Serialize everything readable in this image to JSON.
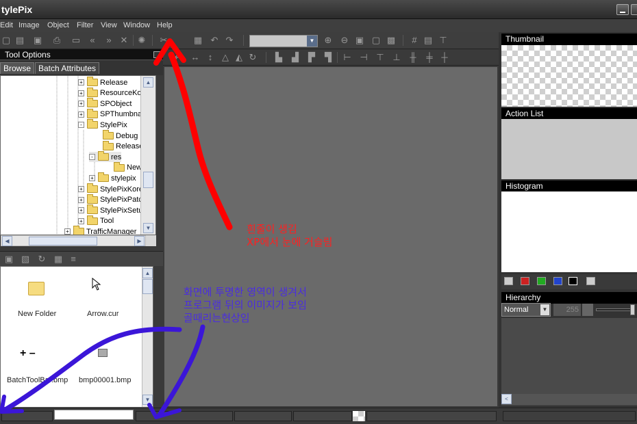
{
  "app": {
    "title": "tylePix"
  },
  "menu": [
    "Edit",
    "Image",
    "Object",
    "Filter",
    "View",
    "Window",
    "Help"
  ],
  "left_panel": {
    "header": "Tool Options",
    "tabs": [
      "Browse",
      "Batch Attributes"
    ],
    "tree": [
      {
        "label": "Release",
        "expander": "+"
      },
      {
        "label": "ResourceKor",
        "expander": "+"
      },
      {
        "label": "SPObject",
        "expander": "+"
      },
      {
        "label": "SPThumbnai",
        "expander": "+"
      },
      {
        "label": "StylePix",
        "expander": "-"
      },
      {
        "label": "Debug",
        "expander": ""
      },
      {
        "label": "Release",
        "expander": ""
      },
      {
        "label": "res",
        "expander": "-"
      },
      {
        "label": "New",
        "expander": ""
      },
      {
        "label": "stylepix",
        "expander": "+"
      },
      {
        "label": "StylePixKore",
        "expander": "+"
      },
      {
        "label": "StylePixPatc",
        "expander": "+"
      },
      {
        "label": "StylePixSetu",
        "expander": "+"
      },
      {
        "label": "Tool",
        "expander": "+"
      },
      {
        "label": "TrafficManager",
        "expander": "+"
      }
    ],
    "files": [
      {
        "name": "New Folder",
        "icon": "folder-icon"
      },
      {
        "name": "Arrow.cur",
        "icon": "cursor-icon"
      },
      {
        "name": "BatchToolBar.bmp",
        "icon": "plus-minus-icon"
      },
      {
        "name": "bmp00001.bmp",
        "icon": "bitmap-icon"
      }
    ]
  },
  "right_panel": {
    "thumbnail_header": "Thumbnail",
    "action_list_header": "Action List",
    "histogram_header": "Histogram",
    "hierarchy_header": "Hierarchy",
    "blend_mode": "Normal",
    "opacity": "255",
    "channel_colors": [
      "#cccccc",
      "#cc2222",
      "#22aa22",
      "#2244cc",
      "#000000",
      "#cccccc"
    ]
  },
  "annotations": {
    "red": [
      "흰줄이 생김",
      "XP에서 눈에 거슬림"
    ],
    "blue": [
      "화면에 투명한 영역이 생겨서",
      "프로그램 뒤의 이미지가 보임",
      "골때리는현상임"
    ],
    "red_color": "#ff2020",
    "blue_color": "#4a2de0"
  }
}
